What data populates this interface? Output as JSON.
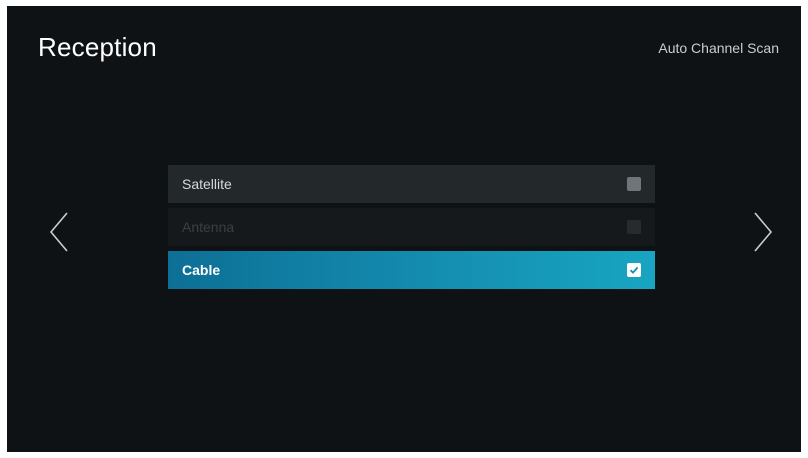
{
  "header": {
    "title": "Reception",
    "breadcrumb": "Auto Channel Scan"
  },
  "navigation": {
    "left_icon": "chevron-left-icon",
    "right_icon": "chevron-right-icon"
  },
  "options": [
    {
      "label": "Satellite",
      "state": "normal",
      "checked": false
    },
    {
      "label": "Antenna",
      "state": "disabled",
      "checked": false
    },
    {
      "label": "Cable",
      "state": "selected",
      "checked": true
    }
  ],
  "colors": {
    "background": "#0e1214",
    "selected_accent": "#1590b3",
    "row_background": "#23282b"
  }
}
